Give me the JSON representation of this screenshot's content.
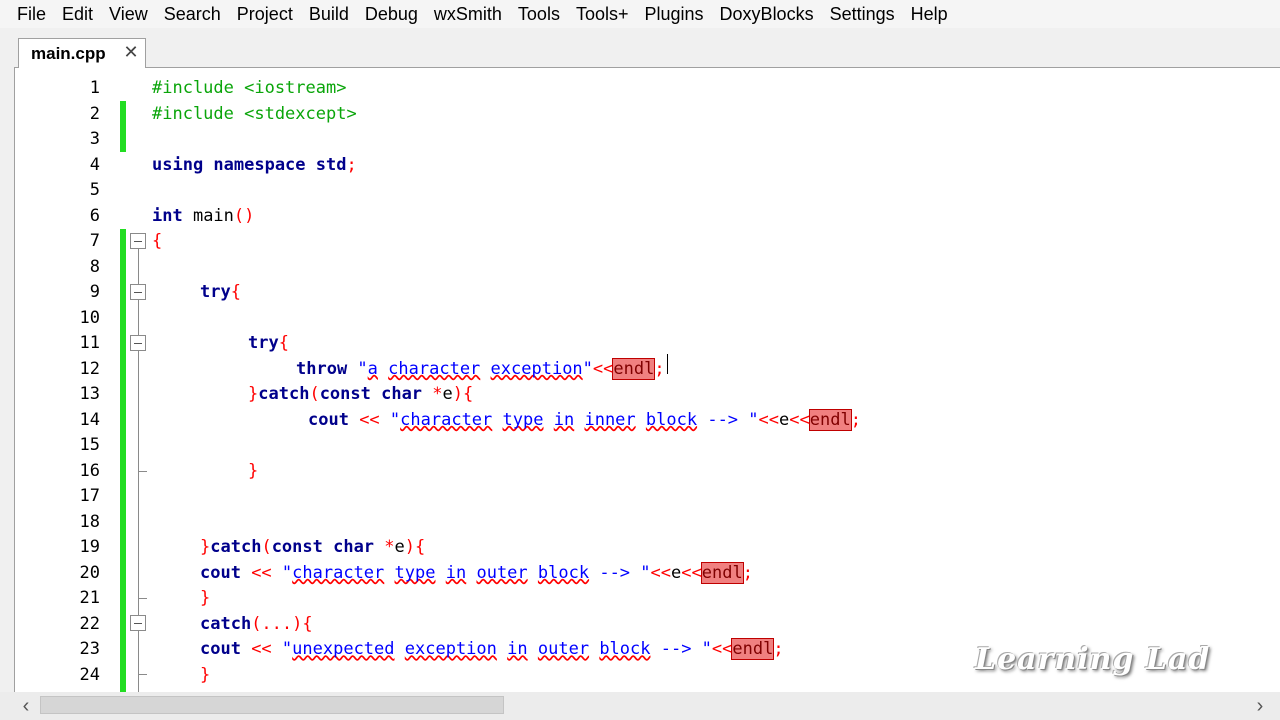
{
  "menu": [
    "File",
    "Edit",
    "View",
    "Search",
    "Project",
    "Build",
    "Debug",
    "wxSmith",
    "Tools",
    "Tools+",
    "Plugins",
    "DoxyBlocks",
    "Settings",
    "Help"
  ],
  "tab": {
    "label": "main.cpp",
    "close": "✕"
  },
  "line_numbers": [
    "1",
    "2",
    "3",
    "4",
    "5",
    "6",
    "7",
    "8",
    "9",
    "10",
    "11",
    "12",
    "13",
    "14",
    "15",
    "16",
    "17",
    "18",
    "19",
    "20",
    "21",
    "22",
    "23",
    "24"
  ],
  "code": {
    "l1": "#include <iostream>",
    "l2": "#include <stdexcept>",
    "l4_kw": "using namespace std",
    "l4_semi": ";",
    "l6_kw": "int",
    "l6_fn": " main",
    "l6_paren": "()",
    "l7": "{",
    "l9_kw": "try",
    "l9_op": "{",
    "l11_kw": "try",
    "l11_op": "{",
    "l12_kw": "throw",
    "l12_q1": " \"",
    "l12_s1": "a",
    "l12_sp1": " ",
    "l12_s2": "character",
    "l12_sp2": " ",
    "l12_s3": "exception",
    "l12_q2": "\"",
    "l12_op": "<<",
    "l12_endl": "endl",
    "l12_semi": ";",
    "l13_op1": "}",
    "l13_kw1": "catch",
    "l13_op2": "(",
    "l13_kw2": "const char",
    "l13_star": " *",
    "l13_e": "e",
    "l13_op3": "){",
    "l14_kw": "cout",
    "l14_op1": " << ",
    "l14_q1": "\"",
    "l14_s1": "character",
    "l14_sp1": " ",
    "l14_s2": "type",
    "l14_sp2": " ",
    "l14_s3": "in",
    "l14_sp3": " ",
    "l14_s4": "inner",
    "l14_sp4": " ",
    "l14_s5": "block",
    "l14_s6": " --> \"",
    "l14_op2": "<<",
    "l14_e": "e",
    "l14_op3": "<<",
    "l14_endl": "endl",
    "l14_semi": ";",
    "l16": "}",
    "l19_op1": "}",
    "l19_kw1": "catch",
    "l19_op2": "(",
    "l19_kw2": "const char",
    "l19_star": " *",
    "l19_e": "e",
    "l19_op3": "){",
    "l20_kw": "cout",
    "l20_op1": " << ",
    "l20_q1": "\"",
    "l20_s1": "character",
    "l20_sp1": " ",
    "l20_s2": "type",
    "l20_sp2": " ",
    "l20_s3": "in",
    "l20_sp3": " ",
    "l20_s4": "outer",
    "l20_sp4": " ",
    "l20_s5": "block",
    "l20_s6": " --> \"",
    "l20_op2": "<<",
    "l20_e": "e",
    "l20_op3": "<<",
    "l20_endl": "endl",
    "l20_semi": ";",
    "l21": "}",
    "l22_kw": "catch",
    "l22_op": "(...){",
    "l23_kw": "cout",
    "l23_op1": " << ",
    "l23_q1": "\"",
    "l23_s1": "unexpected",
    "l23_sp1": " ",
    "l23_s2": "exception",
    "l23_sp2": " ",
    "l23_s3": "in",
    "l23_sp3": " ",
    "l23_s4": "outer",
    "l23_sp4": " ",
    "l23_s5": "block",
    "l23_s6": " --> \"",
    "l23_op2": "<<",
    "l23_endl": "endl",
    "l23_semi": ";",
    "l24": "}"
  },
  "watermark": "Learning Lad",
  "scrollbar": {
    "left_arrow": "‹",
    "right_arrow": "›"
  },
  "colors": {
    "preprocessor": "#0aa50a",
    "keyword": "#00008b",
    "operator": "#ff0000",
    "string": "#0000ff",
    "changebar": "#22dd22",
    "error_highlight": "#f08080"
  }
}
